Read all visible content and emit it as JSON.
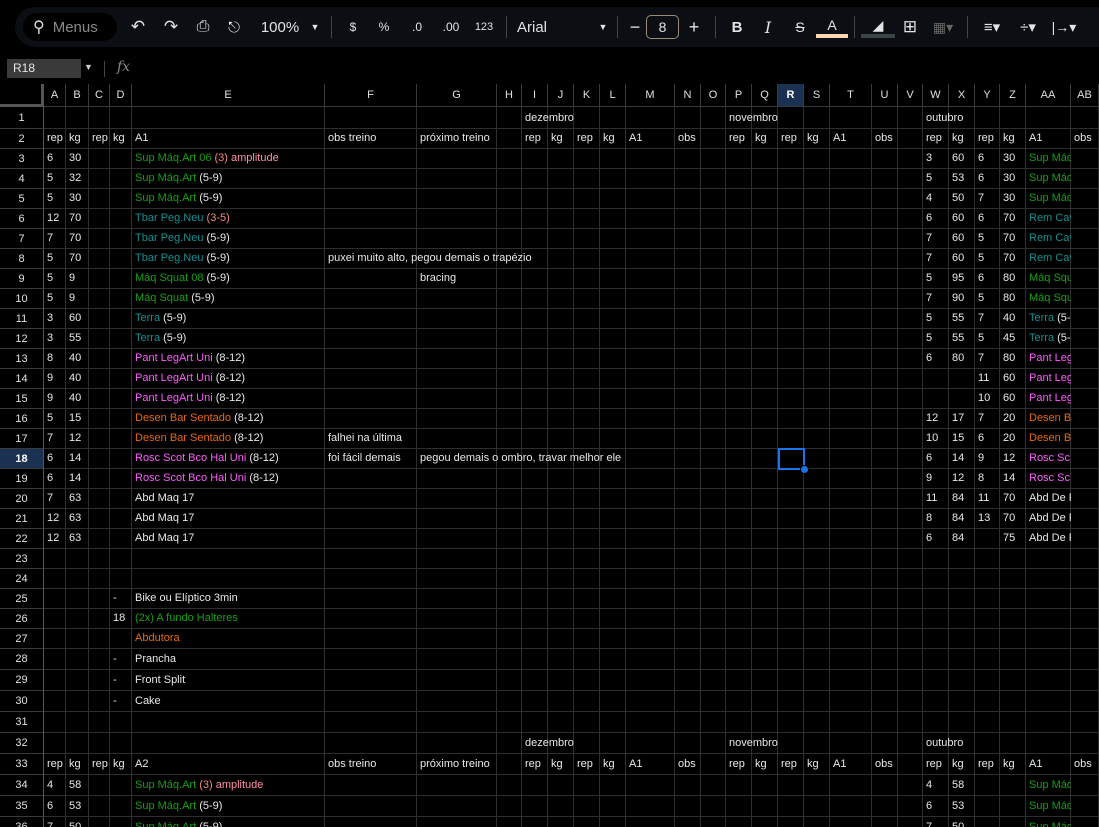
{
  "toolbar": {
    "search_placeholder": "Menus",
    "zoom": "100%",
    "currency": "$",
    "percent": "%",
    "dec_decrease": ".0",
    "dec_increase": ".00",
    "number_format": "123",
    "font": "Arial",
    "font_size": "8"
  },
  "formula_bar": {
    "name_box": "R18",
    "fx": "fx",
    "value": ""
  },
  "colors": {
    "g": "#15a015",
    "t": "#129090",
    "s": "#f08a7a",
    "p": "#ff8fa8",
    "m": "#ff5cff",
    "o": "#e8680e",
    "w": "#e8e8e8",
    "accent": "#1a73e8"
  },
  "selected": {
    "col": "R",
    "row": 18
  },
  "columns": [
    "A",
    "B",
    "C",
    "D",
    "E",
    "F",
    "G",
    "H",
    "I",
    "J",
    "K",
    "L",
    "M",
    "N",
    "O",
    "P",
    "Q",
    "R",
    "S",
    "T",
    "U",
    "V",
    "W",
    "X",
    "Y",
    "Z",
    "AA",
    "AB"
  ],
  "rows": [
    {
      "n": 1,
      "cells": {
        "I": "dezembro",
        "P": "novembro",
        "W": "outubro"
      }
    },
    {
      "n": 2,
      "cells": {
        "A": "rep",
        "B": "kg",
        "C": "rep",
        "D": "kg",
        "E": "A1",
        "F": "obs treino",
        "G": "próximo treino",
        "I": "rep",
        "J": "kg",
        "K": "rep",
        "L": "kg",
        "M": "A1",
        "N": "obs",
        "P": "rep",
        "Q": "kg",
        "R": "rep",
        "S": "kg",
        "T": "A1",
        "U": "obs",
        "W": "rep",
        "X": "kg",
        "Y": "rep",
        "Z": "kg",
        "AA": "A1",
        "AB": "obs"
      }
    },
    {
      "n": 3,
      "cells": {
        "A": "6",
        "B": "30",
        "E": [
          [
            "Sup Máq.Art 06",
            "g"
          ],
          [
            " (3)",
            "s"
          ],
          [
            " amplitude",
            "p"
          ]
        ],
        "W": "3",
        "X": "60",
        "Y": "6",
        "Z": "30",
        "AA": [
          [
            "Sup Máq",
            "g"
          ]
        ]
      }
    },
    {
      "n": 4,
      "cells": {
        "A": "5",
        "B": "32",
        "E": [
          [
            "Sup Máq.Art",
            "g"
          ],
          [
            " (5-9)",
            "w"
          ]
        ],
        "W": "5",
        "X": "53",
        "Y": "6",
        "Z": "30",
        "AA": [
          [
            "Sup Máq",
            "g"
          ]
        ]
      }
    },
    {
      "n": 5,
      "cells": {
        "A": "5",
        "B": "30",
        "E": [
          [
            "Sup Máq.Art",
            "g"
          ],
          [
            " (5-9)",
            "w"
          ]
        ],
        "W": "4",
        "X": "50",
        "Y": "7",
        "Z": "30",
        "AA": [
          [
            "Sup Máq",
            "g"
          ]
        ]
      }
    },
    {
      "n": 6,
      "cells": {
        "A": "12",
        "B": "70",
        "E": [
          [
            "Tbar Peg.Neu",
            "t"
          ],
          [
            "  (3-5)",
            "s"
          ]
        ],
        "W": "6",
        "X": "60",
        "Y": "6",
        "Z": "70",
        "AA": [
          [
            "Rem Cav",
            "t"
          ]
        ]
      }
    },
    {
      "n": 7,
      "cells": {
        "A": "7",
        "B": "70",
        "E": [
          [
            "Tbar Peg.Neu",
            "t"
          ],
          [
            "  (5-9)",
            "w"
          ]
        ],
        "W": "7",
        "X": "60",
        "Y": "5",
        "Z": "70",
        "AA": [
          [
            "Rem Cav",
            "t"
          ]
        ]
      }
    },
    {
      "n": 8,
      "cells": {
        "A": "5",
        "B": "70",
        "E": [
          [
            "Tbar Peg.Neu",
            "t"
          ],
          [
            "  (5-9)",
            "w"
          ]
        ],
        "F": "puxei muito alto, pegou demais o trapézio",
        "W": "7",
        "X": "60",
        "Y": "5",
        "Z": "70",
        "AA": [
          [
            "Rem Cav",
            "t"
          ]
        ]
      }
    },
    {
      "n": 9,
      "cells": {
        "A": "5",
        "B": "9",
        "E": [
          [
            "Máq Squat 08",
            "g"
          ],
          [
            " (5-9)",
            "w"
          ]
        ],
        "G": "bracing",
        "W": "5",
        "X": "95",
        "Y": "6",
        "Z": "80",
        "AA": [
          [
            "Máq Squ",
            "g"
          ]
        ]
      }
    },
    {
      "n": 10,
      "cells": {
        "A": "5",
        "B": "9",
        "E": [
          [
            "Máq Squat",
            "g"
          ],
          [
            " (5-9)",
            "w"
          ]
        ],
        "W": "7",
        "X": "90",
        "Y": "5",
        "Z": "80",
        "AA": [
          [
            "Máq Squ",
            "g"
          ]
        ]
      }
    },
    {
      "n": 11,
      "cells": {
        "A": "3",
        "B": "60",
        "E": [
          [
            "Terra",
            "t"
          ],
          [
            " (5-9)",
            "w"
          ]
        ],
        "W": "5",
        "X": "55",
        "Y": "7",
        "Z": "40",
        "AA": [
          [
            "Terra",
            "t"
          ],
          [
            " (5-",
            "w"
          ]
        ]
      }
    },
    {
      "n": 12,
      "cells": {
        "A": "3",
        "B": "55",
        "E": [
          [
            "Terra",
            "t"
          ],
          [
            " (5-9)",
            "w"
          ]
        ],
        "W": "5",
        "X": "55",
        "Y": "5",
        "Z": "45",
        "AA": [
          [
            "Terra",
            "t"
          ],
          [
            " (5-",
            "w"
          ]
        ]
      }
    },
    {
      "n": 13,
      "cells": {
        "A": "8",
        "B": "40",
        "E": [
          [
            "Pant LegArt Uni",
            "m"
          ],
          [
            " (8-12)",
            "w"
          ]
        ],
        "W": "6",
        "X": "80",
        "Y": "7",
        "Z": "80",
        "AA": [
          [
            "Pant Leg",
            "m"
          ]
        ]
      }
    },
    {
      "n": 14,
      "cells": {
        "A": "9",
        "B": "40",
        "E": [
          [
            "Pant LegArt Uni",
            "m"
          ],
          [
            " (8-12)",
            "w"
          ]
        ],
        "Y": "11",
        "Z": "60",
        "AA": [
          [
            "Pant Leg",
            "m"
          ]
        ]
      }
    },
    {
      "n": 15,
      "cells": {
        "A": "9",
        "B": "40",
        "E": [
          [
            "Pant LegArt Uni",
            "m"
          ],
          [
            " (8-12)",
            "w"
          ]
        ],
        "Y": "10",
        "Z": "60",
        "AA": [
          [
            "Pant Leg",
            "m"
          ]
        ]
      }
    },
    {
      "n": 16,
      "cells": {
        "A": "5",
        "B": "15",
        "E": [
          [
            "Desen Bar Sentado",
            "o"
          ],
          [
            " (8-12)",
            "w"
          ]
        ],
        "W": "12",
        "X": "17",
        "Y": "7",
        "Z": "20",
        "AA": [
          [
            "Desen B",
            "o"
          ]
        ]
      }
    },
    {
      "n": 17,
      "cells": {
        "A": "7",
        "B": "12",
        "E": [
          [
            "Desen Bar Sentado",
            "o"
          ],
          [
            " (8-12)",
            "w"
          ]
        ],
        "F": "falhei na última",
        "W": "10",
        "X": "15",
        "Y": "6",
        "Z": "20",
        "AA": [
          [
            "Desen B",
            "o"
          ]
        ]
      }
    },
    {
      "n": 18,
      "cells": {
        "A": "6",
        "B": "14",
        "E": [
          [
            "Rosc Scot Bco Hal Uni",
            "m"
          ],
          [
            " (8-12)",
            "w"
          ]
        ],
        "F": "foi fácil demais",
        "G": "pegou demais o ombro, travar melhor ele",
        "W": "6",
        "X": "14",
        "Y": "9",
        "Z": "12",
        "AA": [
          [
            "Rosc Sc",
            "m"
          ]
        ]
      }
    },
    {
      "n": 19,
      "cells": {
        "A": "6",
        "B": "14",
        "E": [
          [
            "Rosc Scot Bco Hal Uni",
            "m"
          ],
          [
            " (8-12)",
            "w"
          ]
        ],
        "W": "9",
        "X": "12",
        "Y": "8",
        "Z": "14",
        "AA": [
          [
            "Rosc Sc",
            "m"
          ]
        ]
      }
    },
    {
      "n": 20,
      "cells": {
        "A": "7",
        "B": "63",
        "E": "Abd Maq 17",
        "W": "11",
        "X": "84",
        "Y": "11",
        "Z": "70",
        "AA": "Abd De F"
      }
    },
    {
      "n": 21,
      "cells": {
        "A": "12",
        "B": "63",
        "E": "Abd Maq 17",
        "W": "8",
        "X": "84",
        "Y": "13",
        "Z": "70",
        "AA": "Abd De F"
      }
    },
    {
      "n": 22,
      "cells": {
        "A": "12",
        "B": "63",
        "E": "Abd Maq 17",
        "W": "6",
        "X": "84",
        "Z": "75",
        "AA": "Abd De F"
      }
    },
    {
      "n": 23,
      "cells": {}
    },
    {
      "n": 24,
      "cells": {}
    },
    {
      "n": 25,
      "cells": {
        "D": "-",
        "E": "Bike ou Elíptico 3min"
      }
    },
    {
      "n": 26,
      "cells": {
        "D": "18",
        "E": [
          [
            "(2x) A fundo Halteres",
            "g"
          ]
        ]
      }
    },
    {
      "n": 27,
      "cells": {
        "E": [
          [
            "Abdutora",
            "o"
          ]
        ]
      }
    },
    {
      "n": 28,
      "cells": {
        "D": "-",
        "E": "Prancha"
      }
    },
    {
      "n": 29,
      "cells": {
        "D": "-",
        "E": "Front Split"
      }
    },
    {
      "n": 30,
      "cells": {
        "D": "-",
        "E": "Cake"
      }
    },
    {
      "n": 31,
      "cells": {}
    },
    {
      "n": 32,
      "cells": {
        "I": "dezembro",
        "P": "novembro",
        "W": "outubro"
      }
    },
    {
      "n": 33,
      "cells": {
        "A": "rep",
        "B": "kg",
        "C": "rep",
        "D": "kg",
        "E": "A2",
        "F": "obs treino",
        "G": "próximo treino",
        "I": "rep",
        "J": "kg",
        "K": "rep",
        "L": "kg",
        "M": "A1",
        "N": "obs",
        "P": "rep",
        "Q": "kg",
        "R": "rep",
        "S": "kg",
        "T": "A1",
        "U": "obs",
        "W": "rep",
        "X": "kg",
        "Y": "rep",
        "Z": "kg",
        "AA": "A1",
        "AB": "obs"
      }
    },
    {
      "n": 34,
      "cells": {
        "A": "4",
        "B": "58",
        "E": [
          [
            "Sup Máq.Art",
            "g"
          ],
          [
            " (3)",
            "s"
          ],
          [
            " amplitude",
            "p"
          ]
        ],
        "W": "4",
        "X": "58",
        "AA": [
          [
            "Sup Máq",
            "g"
          ]
        ]
      }
    },
    {
      "n": 35,
      "cells": {
        "A": "6",
        "B": "53",
        "E": [
          [
            "Sup Máq.Art",
            "g"
          ],
          [
            " (5-9)",
            "w"
          ]
        ],
        "W": "6",
        "X": "53",
        "AA": [
          [
            "Sup Máq",
            "g"
          ]
        ]
      }
    },
    {
      "n": 36,
      "cells": {
        "A": "7",
        "B": "50",
        "E": [
          [
            "Sup Máq.Art",
            "g"
          ],
          [
            " (5-9)",
            "w"
          ]
        ],
        "W": "7",
        "X": "50",
        "AA": [
          [
            "Sup Máq",
            "g"
          ]
        ]
      }
    }
  ]
}
